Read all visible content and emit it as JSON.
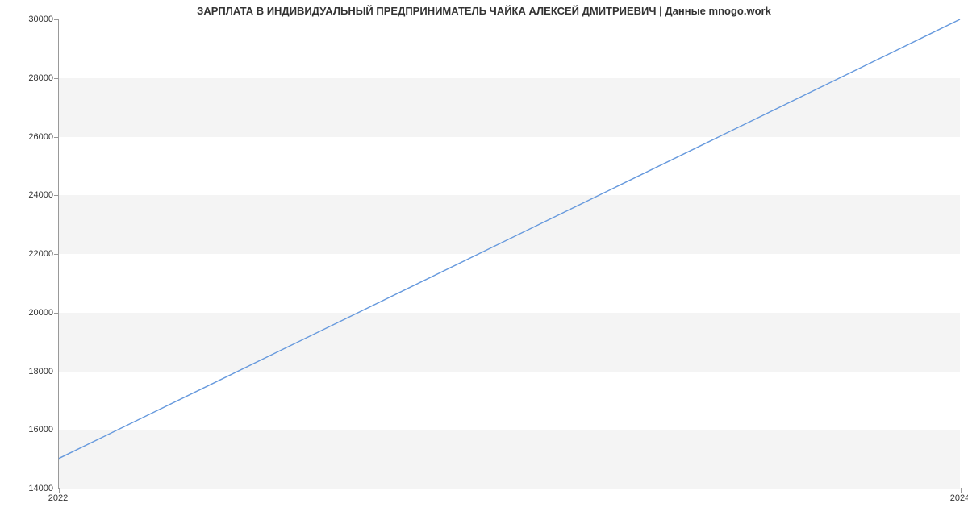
{
  "chart_data": {
    "type": "line",
    "title": "ЗАРПЛАТА В ИНДИВИДУАЛЬНЫЙ ПРЕДПРИНИМАТЕЛЬ ЧАЙКА АЛЕКСЕЙ ДМИТРИЕВИЧ | Данные mnogo.work",
    "x": [
      2022,
      2024
    ],
    "values": [
      15000,
      30000
    ],
    "xlabel": "",
    "ylabel": "",
    "xlim": [
      2022,
      2024
    ],
    "ylim": [
      14000,
      30000
    ],
    "y_ticks": [
      14000,
      16000,
      18000,
      20000,
      22000,
      24000,
      26000,
      28000,
      30000
    ],
    "x_ticks": [
      2022,
      2024
    ],
    "grid": "banded"
  }
}
